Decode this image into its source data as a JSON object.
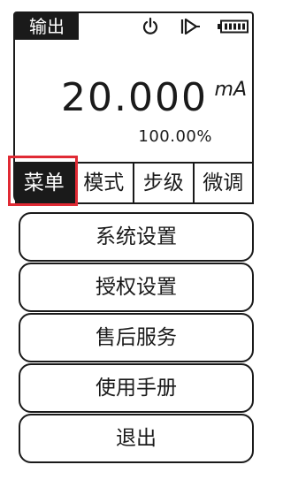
{
  "header": {
    "mode_label": "输出",
    "icons": [
      "power-icon",
      "output-arrow-icon",
      "battery-icon"
    ]
  },
  "reading": {
    "value": "20.000",
    "unit": "mA",
    "percent": "100.00%"
  },
  "tabs": [
    {
      "label": "菜单",
      "active": true
    },
    {
      "label": "模式",
      "active": false
    },
    {
      "label": "步级",
      "active": false
    },
    {
      "label": "微调",
      "active": false
    }
  ],
  "menu": {
    "items": [
      {
        "label": "系统设置"
      },
      {
        "label": "授权设置"
      },
      {
        "label": "售后服务"
      },
      {
        "label": "使用手册"
      },
      {
        "label": "退出"
      }
    ]
  },
  "colors": {
    "foreground": "#1a1a1a",
    "highlight": "#e02a34",
    "background": "#ffffff"
  }
}
